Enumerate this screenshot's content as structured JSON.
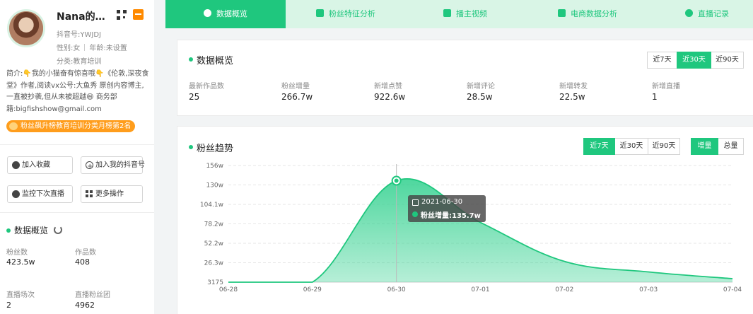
{
  "profile": {
    "name": "Nana的龙…",
    "douyin_id": "抖音号:YWJDJ",
    "gender": "性别:女",
    "age": "年龄:未设置",
    "category": "分类:教育培训",
    "bio": "简介:👇我的小猫奋有惊喜哦👇《伦敦,深夜食堂》作者,阅读vx公号:大鱼秀 原创内容博主,一直被抄袭,但从未被超越😄 商务部籍:bigfishshow@gmail.com",
    "rank_badge": "粉丝飙升榜教育培训分类月榜第2名",
    "icons": {
      "qr": "qr-code-icon",
      "shop": "shop-icon",
      "avatar": "avatar-photo"
    }
  },
  "actions": {
    "favorite": "加入收藏",
    "add_douyin": "加入我的抖音号",
    "monitor_live": "监控下次直播",
    "more": "更多操作"
  },
  "side_overview": {
    "title": "数据概览",
    "stats": [
      {
        "label": "粉丝数",
        "value": "423.5w"
      },
      {
        "label": "作品数",
        "value": "408"
      },
      {
        "label": "直播场次",
        "value": "2"
      },
      {
        "label": "直播粉丝团",
        "value": "4962"
      }
    ]
  },
  "tabs": [
    {
      "label": "数据概览",
      "active": true
    },
    {
      "label": "粉丝特征分析",
      "active": false
    },
    {
      "label": "播主视频",
      "active": false
    },
    {
      "label": "电商数据分析",
      "active": false
    },
    {
      "label": "直播记录",
      "active": false
    }
  ],
  "overview_card": {
    "title": "数据概览",
    "ranges": [
      "近7天",
      "近30天",
      "近90天"
    ],
    "active_range": "近30天",
    "metrics": [
      {
        "label": "最新作品数",
        "value": "25"
      },
      {
        "label": "粉丝增量",
        "value": "266.7w"
      },
      {
        "label": "新增点赞",
        "value": "922.6w"
      },
      {
        "label": "新增评论",
        "value": "28.5w"
      },
      {
        "label": "新增转发",
        "value": "22.5w"
      },
      {
        "label": "新增直播",
        "value": "1"
      }
    ]
  },
  "trend_card": {
    "title": "粉丝趋势",
    "ranges": [
      "近7天",
      "近30天",
      "近90天"
    ],
    "active_range": "近7天",
    "modes": [
      "增量",
      "总量"
    ],
    "active_mode": "增量",
    "tooltip": {
      "date": "2021-06-30",
      "label": "粉丝增量:",
      "value": "135.7w"
    }
  },
  "colors": {
    "accent": "#1fc77e",
    "accent_light": "#d9f5e6",
    "badge": "#ff9d1c"
  },
  "chart_data": {
    "type": "area",
    "x": [
      "06-28",
      "06-29",
      "06-30",
      "07-01",
      "07-02",
      "07-03",
      "07-04"
    ],
    "x_ticks": [
      "06-28",
      "06-29",
      "06-30",
      "07-01",
      "07-02",
      "07-03",
      "07-04"
    ],
    "y_ticks": [
      "3175",
      "26.3w",
      "52.2w",
      "78.2w",
      "104.1w",
      "130w",
      "156w"
    ],
    "series": [
      {
        "values": [
          0.3175,
          0.3175,
          135.7,
          80.0,
          28.0,
          14.0,
          5.0
        ]
      }
    ],
    "ylim": [
      0.3175,
      156
    ],
    "grid": true,
    "highlight": {
      "x": "06-30",
      "value": 135.7
    }
  }
}
